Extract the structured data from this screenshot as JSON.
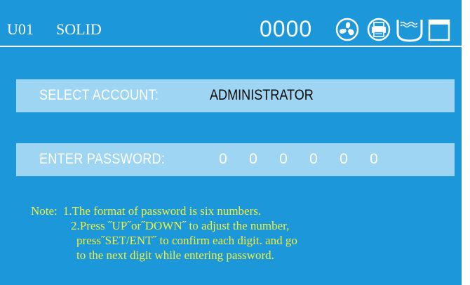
{
  "header": {
    "unit": "U01",
    "mode": "SOLID",
    "counter": "0000",
    "icons": [
      "fan-icon",
      "printer-icon",
      "water-tank-icon",
      "window-icon"
    ]
  },
  "account": {
    "label": "SELECT ACCOUNT:",
    "value": "ADMINISTRATOR"
  },
  "password": {
    "label": "ENTER PASSWORD:",
    "digits": [
      "0",
      "0",
      "0",
      "0",
      "0",
      "0"
    ]
  },
  "note": {
    "prefix": "Note:",
    "line1": "1.The format of password is six numbers.",
    "line2": "2.Press ˝UP˝or˝DOWN˝ to adjust the number,",
    "line3": "press˝SET/ENT˝ to confirm each digit. and go",
    "line4": "to the next digit while entering password."
  },
  "colors": {
    "background": "#1c97d9",
    "field": "#9ed5f2",
    "note": "#f2ef3a"
  }
}
